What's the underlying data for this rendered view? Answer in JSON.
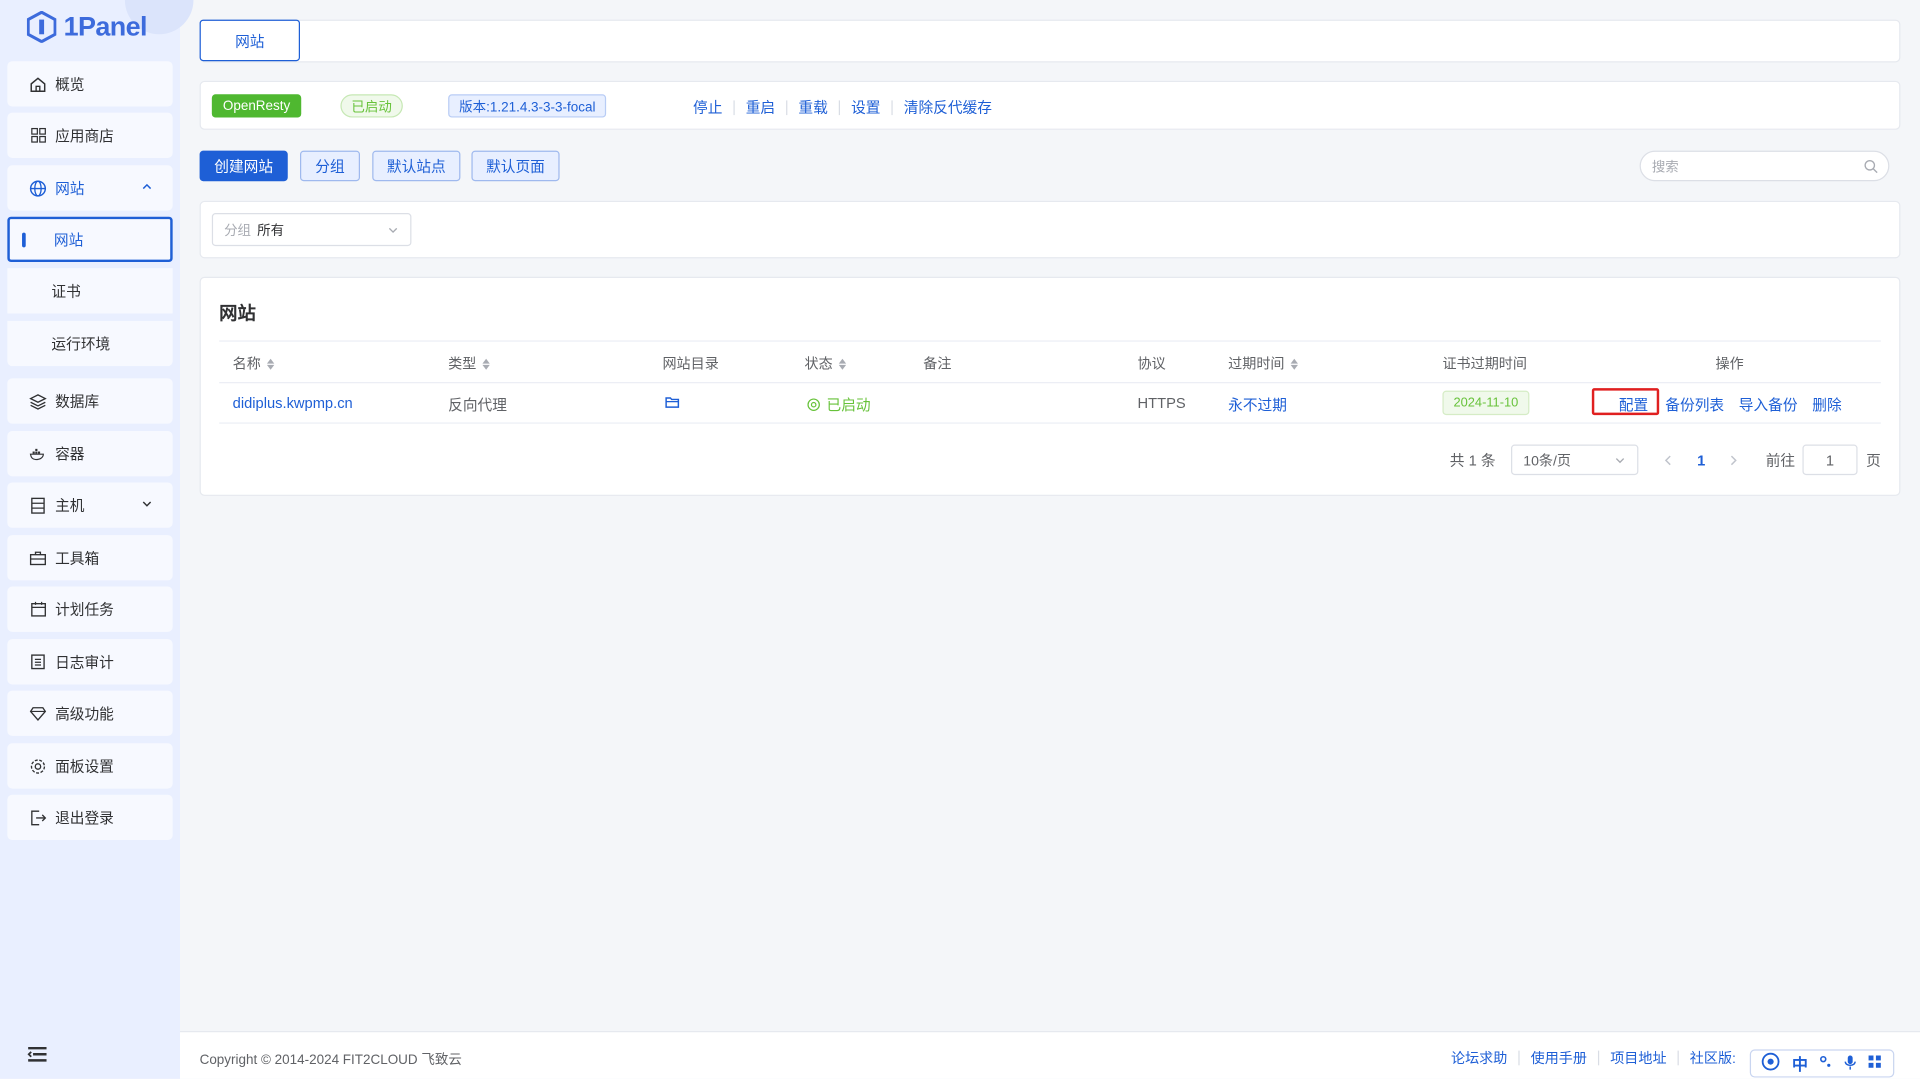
{
  "app": {
    "name": "1Panel"
  },
  "sidebar": {
    "items": [
      {
        "label": "概览"
      },
      {
        "label": "应用商店"
      },
      {
        "label": "网站"
      },
      {
        "label": "数据库"
      },
      {
        "label": "容器"
      },
      {
        "label": "主机"
      },
      {
        "label": "工具箱"
      },
      {
        "label": "计划任务"
      },
      {
        "label": "日志审计"
      },
      {
        "label": "高级功能"
      },
      {
        "label": "面板设置"
      },
      {
        "label": "退出登录"
      }
    ],
    "website_sub": [
      "网站",
      "证书",
      "运行环境"
    ]
  },
  "tabs": {
    "active": "网站"
  },
  "server": {
    "name": "OpenResty",
    "status": "已启动",
    "version": "版本:1.21.4.3-3-3-focal",
    "actions": [
      "停止",
      "重启",
      "重载",
      "设置",
      "清除反代缓存"
    ]
  },
  "toolbar": {
    "create": "创建网站",
    "group": "分组",
    "default_site": "默认站点",
    "default_page": "默认页面",
    "search_placeholder": "搜索"
  },
  "filter": {
    "label": "分组",
    "value": "所有"
  },
  "table": {
    "title": "网站",
    "columns": [
      "名称",
      "类型",
      "网站目录",
      "状态",
      "备注",
      "协议",
      "过期时间",
      "证书过期时间",
      "操作"
    ],
    "rows": [
      {
        "name": "didiplus.kwpmp.cn",
        "type": "反向代理",
        "status": "已启动",
        "remark": "",
        "protocol": "HTTPS",
        "expire": "永不过期",
        "cert_expire": "2024-11-10",
        "actions": [
          "配置",
          "备份列表",
          "导入备份",
          "删除"
        ]
      }
    ]
  },
  "pagination": {
    "total": "共 1 条",
    "page_size": "10条/页",
    "current": "1",
    "goto_label": "前往",
    "goto_value": "1",
    "page_suffix": "页"
  },
  "footer": {
    "copyright": "Copyright © 2014-2024 FIT2CLOUD 飞致云",
    "links": [
      "论坛求助",
      "使用手册",
      "项目地址",
      "社区版:"
    ]
  },
  "ime": {
    "lang": "中"
  },
  "colors": {
    "accent": "#1e5fd6",
    "success": "#67c23a",
    "openresty": "#4fb830",
    "highlight": "#e02020"
  }
}
